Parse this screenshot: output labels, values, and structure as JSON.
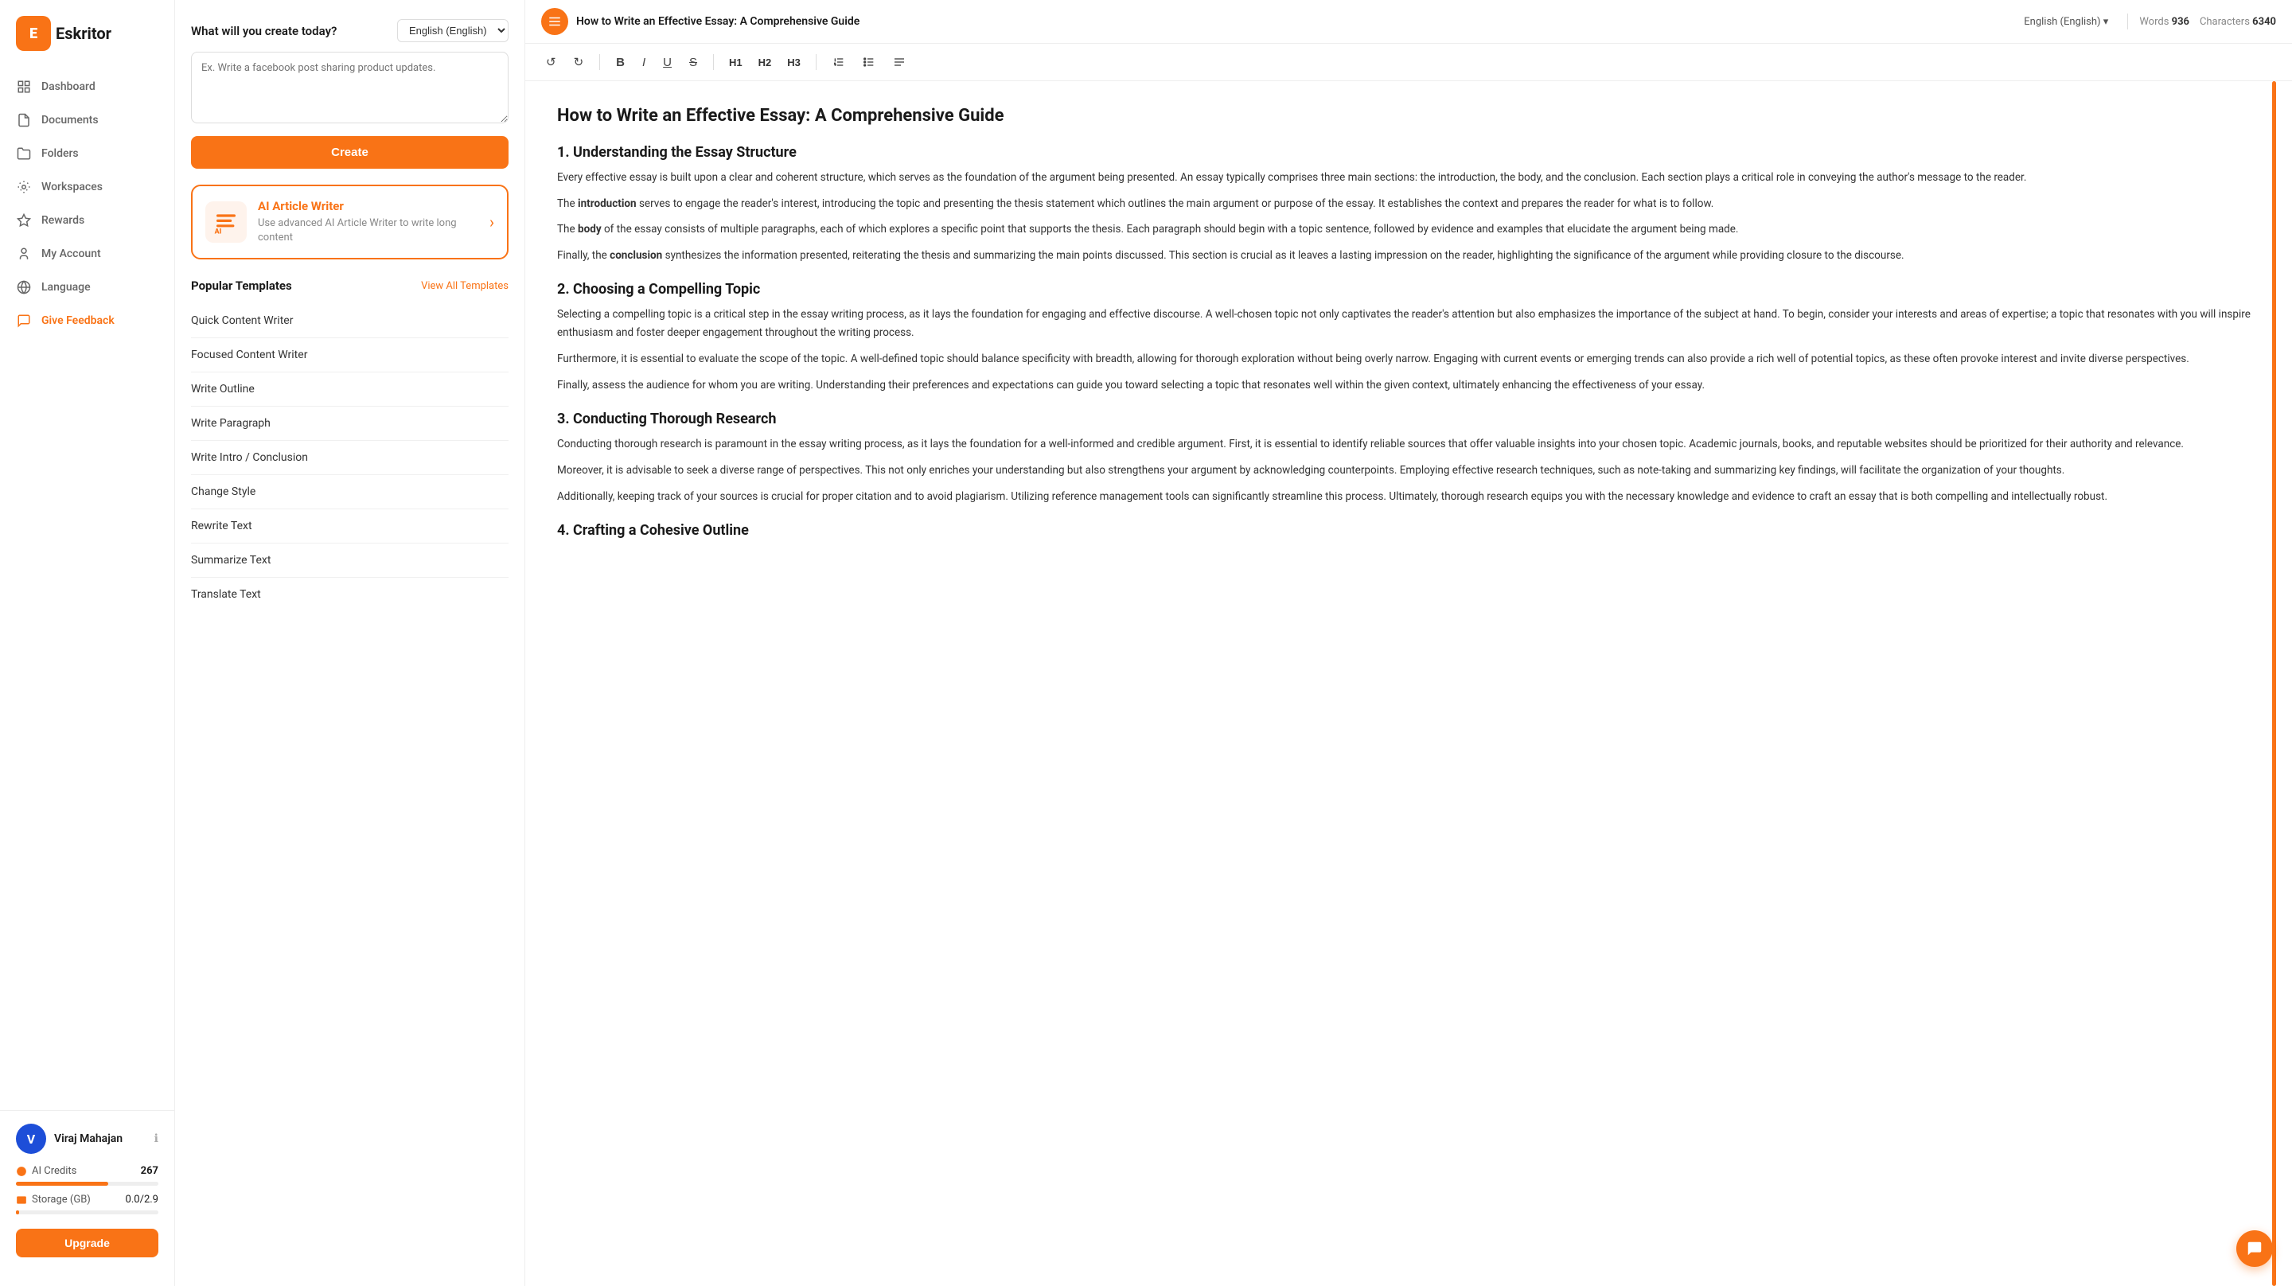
{
  "app": {
    "name": "Eskritor",
    "logo_letter": "E"
  },
  "sidebar": {
    "nav_items": [
      {
        "id": "dashboard",
        "label": "Dashboard",
        "icon": "dashboard-icon"
      },
      {
        "id": "documents",
        "label": "Documents",
        "icon": "documents-icon"
      },
      {
        "id": "folders",
        "label": "Folders",
        "icon": "folders-icon"
      },
      {
        "id": "workspaces",
        "label": "Workspaces",
        "icon": "workspaces-icon"
      },
      {
        "id": "rewards",
        "label": "Rewards",
        "icon": "rewards-icon"
      },
      {
        "id": "my-account",
        "label": "My Account",
        "icon": "account-icon"
      },
      {
        "id": "language",
        "label": "Language",
        "icon": "language-icon"
      },
      {
        "id": "give-feedback",
        "label": "Give Feedback",
        "icon": "feedback-icon"
      }
    ],
    "user": {
      "name": "Viraj Mahajan",
      "avatar_initial": "V"
    },
    "credits": {
      "label": "AI Credits",
      "count": "267",
      "progress_pct": 65
    },
    "storage": {
      "label": "Storage (GB)",
      "value": "0.0/2.9",
      "progress_pct": 2
    },
    "upgrade_label": "Upgrade"
  },
  "left_panel": {
    "create_title": "What will you create today?",
    "language_select": "English (English)",
    "textarea_placeholder": "Ex. Write a facebook post sharing product updates.",
    "create_button": "Create",
    "ai_card": {
      "title": "AI Article Writer",
      "description": "Use advanced AI Article Writer to write long content",
      "badge": "AI"
    },
    "templates_title": "Popular Templates",
    "view_all_label": "View All Templates",
    "templates": [
      "Quick Content Writer",
      "Focused Content Writer",
      "Write Outline",
      "Write Paragraph",
      "Write Intro / Conclusion",
      "Change Style",
      "Rewrite Text",
      "Summarize Text",
      "Translate Text"
    ]
  },
  "editor": {
    "doc_icon": "≡",
    "doc_title": "How to Write an Effective Essay: A Comprehensive Guide",
    "language": "English (English) ▾",
    "words_label": "Words",
    "words_count": "936",
    "chars_label": "Characters",
    "chars_count": "6340",
    "toolbar": {
      "undo": "↺",
      "redo": "↻",
      "bold": "B",
      "italic": "I",
      "underline": "U",
      "strikethrough": "S",
      "h1": "H1",
      "h2": "H2",
      "h3": "H3",
      "list_ordered": "≡",
      "list_unordered": "≡",
      "align": "≡"
    },
    "content": {
      "title": "How to Write an Effective Essay: A Comprehensive Guide",
      "sections": [
        {
          "heading": "1. Understanding the Essay Structure",
          "paragraphs": [
            "Every effective essay is built upon a clear and coherent structure, which serves as the foundation of the argument being presented. An essay typically comprises three main sections: the introduction, the body, and the conclusion. Each section plays a critical role in conveying the author's message to the reader.",
            "The introduction serves to engage the reader's interest, introducing the topic and presenting the thesis statement which outlines the main argument or purpose of the essay. It establishes the context and prepares the reader for what is to follow.",
            "The body of the essay consists of multiple paragraphs, each of which explores a specific point that supports the thesis. Each paragraph should begin with a topic sentence, followed by evidence and examples that elucidate the argument being made.",
            "Finally, the conclusion synthesizes the information presented, reiterating the thesis and summarizing the main points discussed. This section is crucial as it leaves a lasting impression on the reader, highlighting the significance of the argument while providing closure to the discourse."
          ]
        },
        {
          "heading": "2. Choosing a Compelling Topic",
          "paragraphs": [
            "Selecting a compelling topic is a critical step in the essay writing process, as it lays the foundation for engaging and effective discourse. A well-chosen topic not only captivates the reader's attention but also emphasizes the importance of the subject at hand. To begin, consider your interests and areas of expertise; a topic that resonates with you will inspire enthusiasm and foster deeper engagement throughout the writing process.",
            "Furthermore, it is essential to evaluate the scope of the topic. A well-defined topic should balance specificity with breadth, allowing for thorough exploration without being overly narrow. Engaging with current events or emerging trends can also provide a rich well of potential topics, as these often provoke interest and invite diverse perspectives.",
            "Finally, assess the audience for whom you are writing. Understanding their preferences and expectations can guide you toward selecting a topic that resonates well within the given context, ultimately enhancing the effectiveness of your essay."
          ]
        },
        {
          "heading": "3. Conducting Thorough Research",
          "paragraphs": [
            "Conducting thorough research is paramount in the essay writing process, as it lays the foundation for a well-informed and credible argument. First, it is essential to identify reliable sources that offer valuable insights into your chosen topic. Academic journals, books, and reputable websites should be prioritized for their authority and relevance.",
            "Moreover, it is advisable to seek a diverse range of perspectives. This not only enriches your understanding but also strengthens your argument by acknowledging counterpoints. Employing effective research techniques, such as note-taking and summarizing key findings, will facilitate the organization of your thoughts.",
            "Additionally, keeping track of your sources is crucial for proper citation and to avoid plagiarism. Utilizing reference management tools can significantly streamline this process. Ultimately, thorough research equips you with the necessary knowledge and evidence to craft an essay that is both compelling and intellectually robust."
          ]
        },
        {
          "heading": "4. Crafting a Cohesive Outline",
          "paragraphs": []
        }
      ]
    }
  },
  "chat_fab": "💬"
}
